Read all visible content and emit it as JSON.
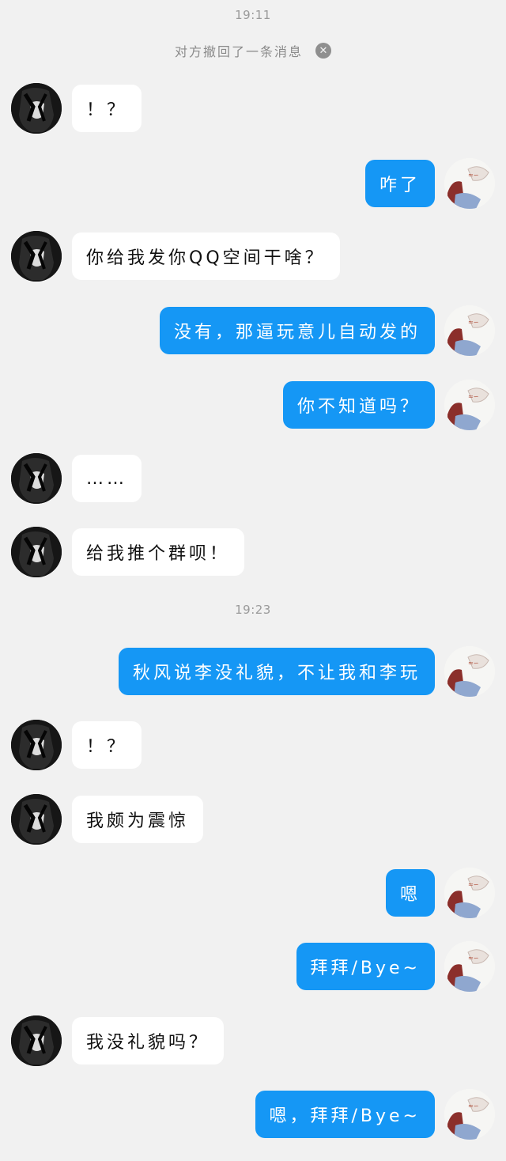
{
  "chat": {
    "timestamps": [
      "19:11",
      "19:23"
    ],
    "recall_notice": "对方撤回了一条消息",
    "recall_close_icon": "close-icon",
    "messages": [
      {
        "side": "in",
        "text": "！？"
      },
      {
        "side": "out",
        "text": "咋了"
      },
      {
        "side": "in",
        "text": "你给我发你QQ空间干啥？"
      },
      {
        "side": "out",
        "text": "没有，那逼玩意儿自动发的"
      },
      {
        "side": "out",
        "text": "你不知道吗？"
      },
      {
        "side": "in",
        "text": "……"
      },
      {
        "side": "in",
        "text": "给我推个群呗！"
      },
      {
        "side": "out",
        "text": "秋风说李没礼貌，不让我和李玩"
      },
      {
        "side": "in",
        "text": "！？"
      },
      {
        "side": "in",
        "text": "我颇为震惊"
      },
      {
        "side": "out",
        "text": "嗯"
      },
      {
        "side": "out",
        "text": "拜拜/Bye~"
      },
      {
        "side": "in",
        "text": "我没礼貌吗？"
      },
      {
        "side": "out",
        "text": "嗯，拜拜/Bye~"
      }
    ]
  },
  "colors": {
    "background": "#f1f1f1",
    "incoming_bubble": "#ffffff",
    "outgoing_bubble": "#1597f5",
    "timestamp_text": "#9a9a9a"
  }
}
